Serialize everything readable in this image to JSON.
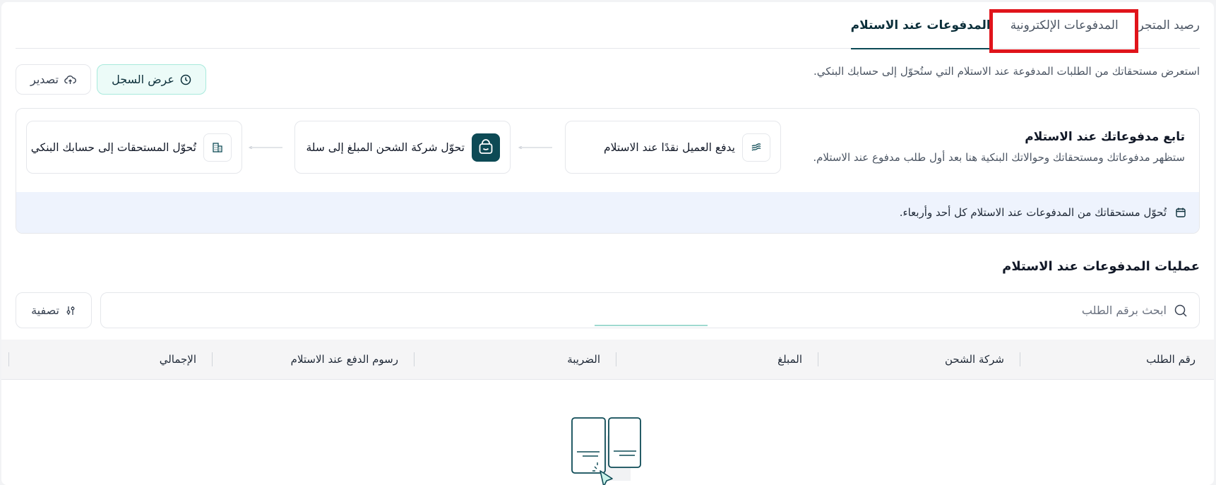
{
  "tabs": [
    {
      "label": "رصيد المتجر",
      "active": false
    },
    {
      "label": "المدفوعات الإلكترونية",
      "active": false
    },
    {
      "label": "المدفوعات عند الاستلام",
      "active": true
    }
  ],
  "header": {
    "description": "استعرض مستحقاتك من الطلبات المدفوعة عند الاستلام التي ستُحوّل إلى حسابك البنكي."
  },
  "actions": {
    "history_label": "عرض السجل",
    "export_label": "تصدير"
  },
  "info_panel": {
    "title": "تابع مدفوعاتك عند الاستلام",
    "subtitle": "ستظهر مدفوعاتك ومستحقاتك وحوالاتك البنكية هنا بعد أول طلب مدفوع عند الاستلام.",
    "steps": [
      {
        "label": "يدفع العميل نقدًا عند الاستلام",
        "icon": "cash-icon"
      },
      {
        "label": "تحوّل شركة الشحن المبلغ إلى سلة",
        "icon": "salla-logo-icon"
      },
      {
        "label": "تُحوّل المستحقات إلى حسابك البنكي",
        "icon": "bank-icon"
      }
    ],
    "notice": "تُحوّل مستحقاتك من المدفوعات عند الاستلام كل أحد وأربعاء."
  },
  "operations": {
    "title": "عمليات المدفوعات عند الاستلام",
    "search_placeholder": "ابحث برقم الطلب",
    "filter_label": "تصفية"
  },
  "table": {
    "columns": [
      "رقم الطلب",
      "شركة الشحن",
      "المبلغ",
      "الضريبة",
      "رسوم الدفع عند الاستلام",
      "الإجمالي"
    ]
  },
  "colors": {
    "accent_dark": "#0d4a55",
    "accent_light": "#ecfbf8",
    "notice_bg": "#eef3fd",
    "highlight": "#e0141b"
  }
}
